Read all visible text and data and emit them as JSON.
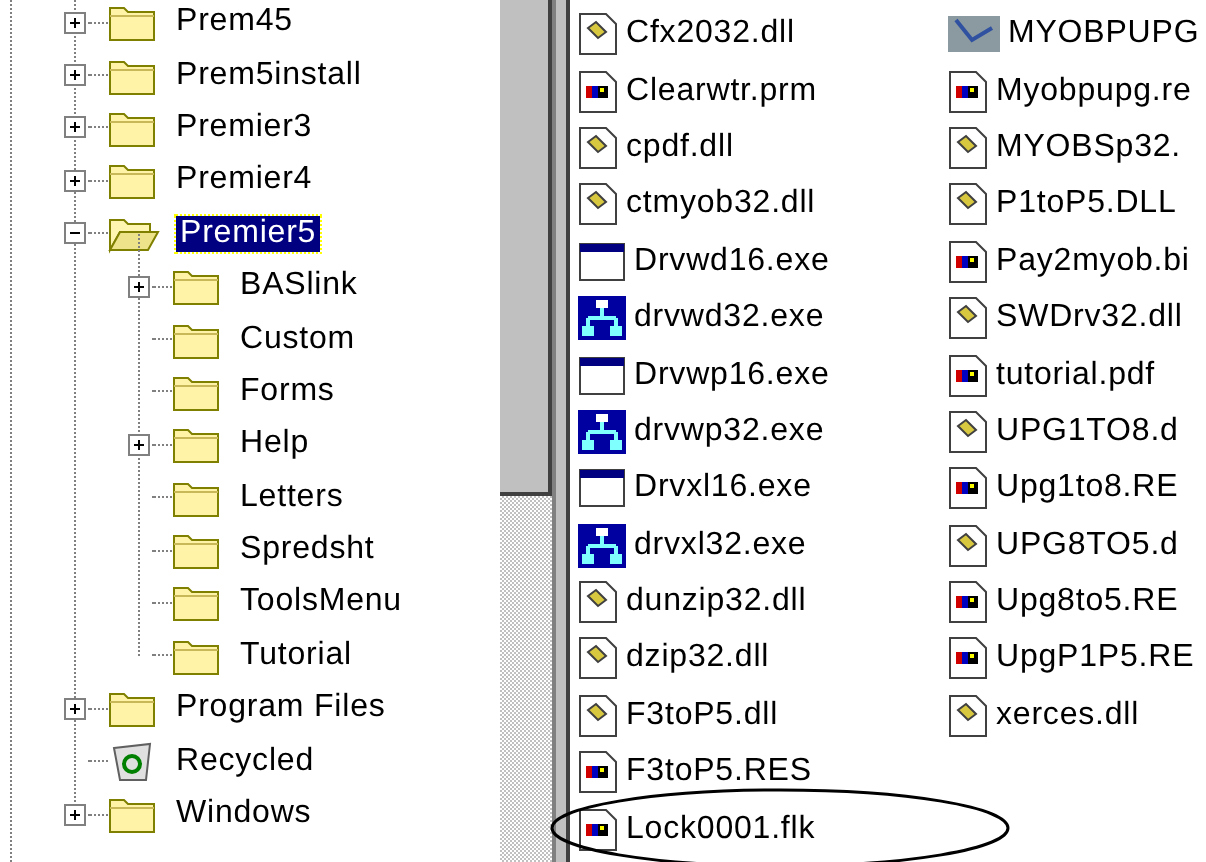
{
  "folder_tree": {
    "items": [
      {
        "label": "Prem45",
        "kind": "folder",
        "expandable": true,
        "expanded": false,
        "selected": false
      },
      {
        "label": "Prem5install",
        "kind": "folder",
        "expandable": true,
        "expanded": false,
        "selected": false
      },
      {
        "label": "Premier3",
        "kind": "folder",
        "expandable": true,
        "expanded": false,
        "selected": false
      },
      {
        "label": "Premier4",
        "kind": "folder",
        "expandable": true,
        "expanded": false,
        "selected": false
      },
      {
        "label": "Premier5",
        "kind": "open-folder",
        "expandable": true,
        "expanded": true,
        "selected": true,
        "children": [
          {
            "label": "BASlink",
            "kind": "folder",
            "expandable": true,
            "expanded": false,
            "selected": false
          },
          {
            "label": "Custom",
            "kind": "folder",
            "expandable": false,
            "selected": false
          },
          {
            "label": "Forms",
            "kind": "folder",
            "expandable": false,
            "selected": false
          },
          {
            "label": "Help",
            "kind": "folder",
            "expandable": true,
            "expanded": false,
            "selected": false
          },
          {
            "label": "Letters",
            "kind": "folder",
            "expandable": false,
            "selected": false
          },
          {
            "label": "Spredsht",
            "kind": "folder",
            "expandable": false,
            "selected": false
          },
          {
            "label": "ToolsMenu",
            "kind": "folder",
            "expandable": false,
            "selected": false
          },
          {
            "label": "Tutorial",
            "kind": "folder",
            "expandable": false,
            "selected": false
          }
        ]
      },
      {
        "label": "Program Files",
        "kind": "folder",
        "expandable": true,
        "expanded": false,
        "selected": false
      },
      {
        "label": "Recycled",
        "kind": "recycle-bin",
        "expandable": false,
        "selected": false
      },
      {
        "label": "Windows",
        "kind": "folder",
        "expandable": true,
        "expanded": false,
        "selected": false
      }
    ]
  },
  "file_list": {
    "columns": [
      [
        {
          "name": "Cfx2032.dll",
          "kind": "dll"
        },
        {
          "name": "Clearwtr.prm",
          "kind": "document"
        },
        {
          "name": "cpdf.dll",
          "kind": "dll"
        },
        {
          "name": "ctmyob32.dll",
          "kind": "dll"
        },
        {
          "name": "Drvwd16.exe",
          "kind": "window"
        },
        {
          "name": "drvwd32.exe",
          "kind": "network"
        },
        {
          "name": "Drvwp16.exe",
          "kind": "window"
        },
        {
          "name": "drvwp32.exe",
          "kind": "network"
        },
        {
          "name": "Drvxl16.exe",
          "kind": "window"
        },
        {
          "name": "drvxl32.exe",
          "kind": "network"
        },
        {
          "name": "dunzip32.dll",
          "kind": "dll"
        },
        {
          "name": "dzip32.dll",
          "kind": "dll"
        },
        {
          "name": "F3toP5.dll",
          "kind": "dll"
        },
        {
          "name": "F3toP5.RES",
          "kind": "document"
        },
        {
          "name": "Lock0001.flk",
          "kind": "document",
          "circled": true
        }
      ],
      [
        {
          "name": "MYOBPUPG",
          "kind": "program"
        },
        {
          "name": "Myobpupg.re",
          "kind": "document"
        },
        {
          "name": "MYOBSp32.",
          "kind": "dll"
        },
        {
          "name": "P1toP5.DLL",
          "kind": "dll"
        },
        {
          "name": "Pay2myob.bi",
          "kind": "document"
        },
        {
          "name": "SWDrv32.dll",
          "kind": "dll"
        },
        {
          "name": "tutorial.pdf",
          "kind": "document"
        },
        {
          "name": "UPG1TO8.d",
          "kind": "dll"
        },
        {
          "name": "Upg1to8.RE",
          "kind": "document"
        },
        {
          "name": "UPG8TO5.d",
          "kind": "dll"
        },
        {
          "name": "Upg8to5.RE",
          "kind": "document"
        },
        {
          "name": "UpgP1P5.RE",
          "kind": "document"
        },
        {
          "name": "xerces.dll",
          "kind": "dll"
        }
      ]
    ]
  }
}
